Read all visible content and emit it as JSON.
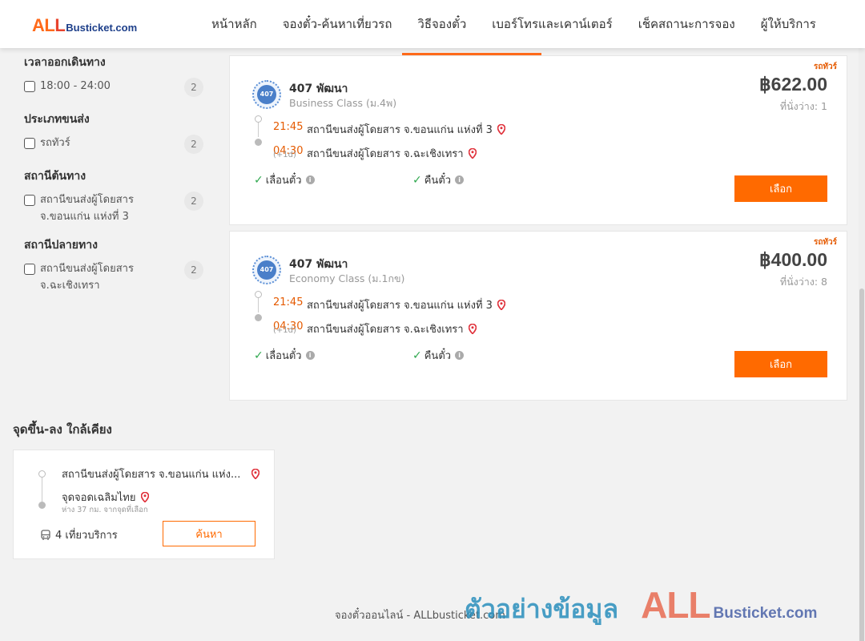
{
  "logo": {
    "all_part1": "AL",
    "all_part2": "L",
    "busticket": "Busticket.com"
  },
  "nav": [
    "หน้าหลัก",
    "จองตั๋ว-ค้นหาเที่ยวรถ",
    "วิธีจองตั๋ว",
    "เบอร์โทรและเคาน์เตอร์",
    "เช็คสถานะการจอง",
    "ผู้ให้บริการ"
  ],
  "filters": {
    "departure_time": {
      "title": "เวลาออกเดินทาง",
      "options": [
        {
          "label": "18:00 - 24:00",
          "count": "2",
          "checked": false
        }
      ]
    },
    "transport_type": {
      "title": "ประเภทขนส่ง",
      "options": [
        {
          "label": "รถทัวร์",
          "count": "2",
          "checked": false
        }
      ]
    },
    "origin_station": {
      "title": "สถานีต้นทาง",
      "options": [
        {
          "label": "สถานีขนส่งผู้โดยสาร จ.ขอนแก่น แห่งที่ 3",
          "count": "2",
          "checked": false
        }
      ]
    },
    "destination_station": {
      "title": "สถานีปลายทาง",
      "options": [
        {
          "label": "สถานีขนส่งผู้โดยสาร จ.ฉะเชิงเทรา",
          "count": "2",
          "checked": false
        }
      ]
    }
  },
  "trips": [
    {
      "tag": "รถทัวร์",
      "operator": "407 พัฒนา",
      "logo_text": "407",
      "bus_class": "Business Class (ม.4พ)",
      "price": "฿622.00",
      "seats": "ที่นั่งว่าง: 1",
      "depart_time": "21:45",
      "depart_station": "สถานีขนส่งผู้โดยสาร จ.ขอนแก่น แห่งที่ 3",
      "arrive_time": "04:30",
      "arrive_station": "สถานีขนส่งผู้โดยสาร จ.ฉะเชิงเทรา",
      "day_offset": "(+1d)",
      "feature_1": "เลื่อนตั๋ว",
      "feature_2": "คืนตั๋ว",
      "select_label": "เลือก"
    },
    {
      "tag": "รถทัวร์",
      "operator": "407 พัฒนา",
      "logo_text": "407",
      "bus_class": "Economy Class (ม.1กข)",
      "price": "฿400.00",
      "seats": "ที่นั่งว่าง: 8",
      "depart_time": "21:45",
      "depart_station": "สถานีขนส่งผู้โดยสาร จ.ขอนแก่น แห่งที่ 3",
      "arrive_time": "04:30",
      "arrive_station": "สถานีขนส่งผู้โดยสาร จ.ฉะเชิงเทรา",
      "day_offset": "(+1d)",
      "feature_1": "เลื่อนตั๋ว",
      "feature_2": "คืนตั๋ว",
      "select_label": "เลือก"
    }
  ],
  "nearby": {
    "title": "จุดขึ้น-ลง ใกล้เคียง",
    "from": "สถานีขนส่งผู้โดยสาร จ.ขอนแก่น แห่ง...",
    "to": "จุดจอดเฉลิมไทย",
    "distance": "ห่าง 37 กม. จากจุดที่เลือก",
    "trips": "4 เที่ยวบริการ",
    "search_label": "ค้นหา"
  },
  "footer": {
    "text": "จองตั๋วออนไลน์ - ALLbusticket.com"
  },
  "watermark": {
    "thai": "ตัวอย่างข้อมูล",
    "all": "ALL",
    "busticket": "Busticket.com"
  },
  "colors": {
    "accent": "#ff6a00",
    "time": "#e55a00",
    "pin": "#e0303a",
    "check": "#2fa84f"
  }
}
